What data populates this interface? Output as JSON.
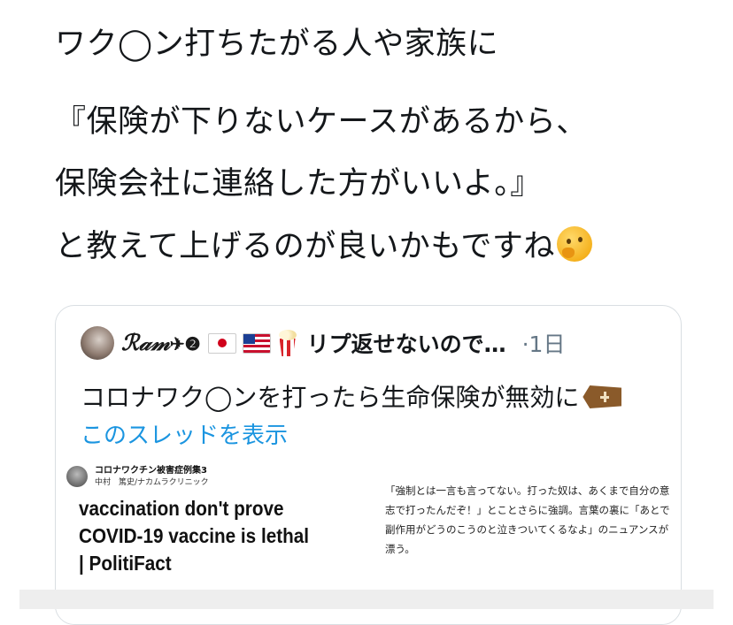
{
  "tweet": {
    "line1": "ワク◯ン打ちたがる人や家族に",
    "line2": "『保険が下りないケースがあるから、",
    "line3": "保険会社に連絡した方がいいよ。』",
    "line4": "と教えて上げるのが良いかもですね",
    "line4_emoji": "thinking-face-icon"
  },
  "quote": {
    "name": "ℛ𝒶𝓂",
    "name_suffix": "✈❷",
    "flags": [
      "japan-flag-icon",
      "usa-flag-icon",
      "popcorn-icon"
    ],
    "title": "リプ返せないので…",
    "time": "·1日",
    "body": "コロナワク◯ンを打ったら生命保険が無効に",
    "body_emoji": "coffin-icon",
    "show_thread": "このスレッドを表示"
  },
  "preview": {
    "account_name": "コロナワクチン被害症例集3",
    "account_sub": "中村　篤史/ナカムラクリニック",
    "headline": "vaccination don't prove COVID-19 vaccine is lethal | PolitiFact",
    "quote_text": "「強制とは一言も言ってない。打った奴は、あくまで自分の意志で打ったんだぞ！」とことさらに強調。言葉の裏に「あとで副作用がどうのこうのと泣きついてくるなよ」のニュアンスが漂う。"
  },
  "colors": {
    "text": "#14171a",
    "muted": "#657786",
    "link": "#1b95e0",
    "border": "#d9dee2"
  }
}
